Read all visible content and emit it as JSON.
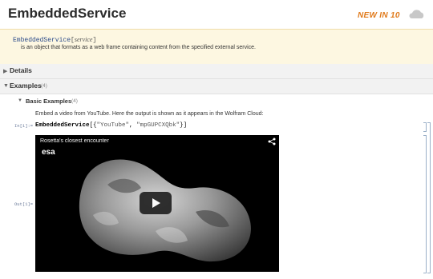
{
  "header": {
    "title": "EmbeddedService",
    "badge": "NEW IN 10",
    "cloud_icon": "cloud-icon"
  },
  "usage": {
    "function": "EmbeddedService",
    "bracket_open": "[",
    "argument": "service",
    "bracket_close": "]",
    "description": "is an object that formats as a web frame containing content from the specified external service."
  },
  "sections": {
    "details": {
      "label": "Details",
      "icon": "triangle-right-icon"
    },
    "examples": {
      "label": "Examples",
      "count": "(4)",
      "icon": "triangle-down-icon"
    },
    "basic_examples": {
      "label": "Basic Examples",
      "count": "(4)",
      "icon": "triangle-down-icon"
    }
  },
  "example": {
    "description": "Embed a video from YouTube. Here the output is shown as it appears in the Wolfram Cloud:",
    "in_label": "In[1]:=",
    "code_fn": "EmbeddedService",
    "code_open": "[{",
    "code_arg1": "\"YouTube\"",
    "code_sep": ", ",
    "code_arg2": "\"mpGUPCXQbk\"",
    "code_close": "}]",
    "out_label": "Out[1]="
  },
  "video": {
    "title": "Rosetta's closest encounter",
    "logo": "esa",
    "share_icon": "share-icon",
    "play_icon": "play-button-icon"
  },
  "colors": {
    "badge": "#e07a1b",
    "usage_background": "#fdf7e1",
    "section_background": "#f2f2f2"
  }
}
